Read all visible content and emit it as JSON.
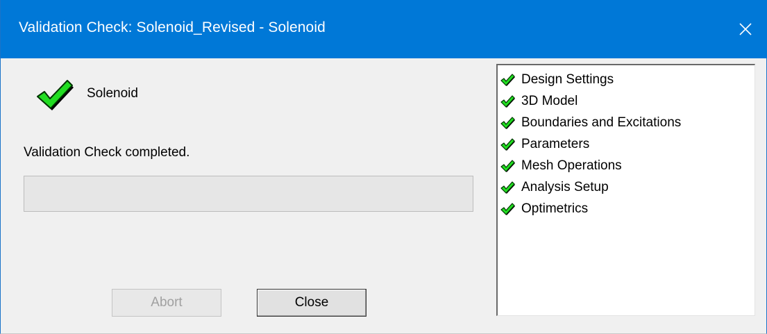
{
  "window": {
    "title": "Validation Check: Solenoid_Revised - Solenoid"
  },
  "design": {
    "name": "Solenoid",
    "icon": "green-check-icon"
  },
  "status": {
    "text": "Validation Check completed.",
    "progress": 0
  },
  "buttons": {
    "abort_label": "Abort",
    "abort_enabled": false,
    "close_label": "Close"
  },
  "checks": {
    "items": [
      {
        "label": "Design Settings",
        "status": "passed"
      },
      {
        "label": "3D Model",
        "status": "passed"
      },
      {
        "label": "Boundaries and Excitations",
        "status": "passed"
      },
      {
        "label": "Parameters",
        "status": "passed"
      },
      {
        "label": "Mesh Operations",
        "status": "passed"
      },
      {
        "label": "Analysis Setup",
        "status": "passed"
      },
      {
        "label": "Optimetrics",
        "status": "passed"
      }
    ]
  },
  "colors": {
    "titlebar": "#0078d7",
    "check_green": "#22dd22",
    "check_outline": "#003300"
  }
}
